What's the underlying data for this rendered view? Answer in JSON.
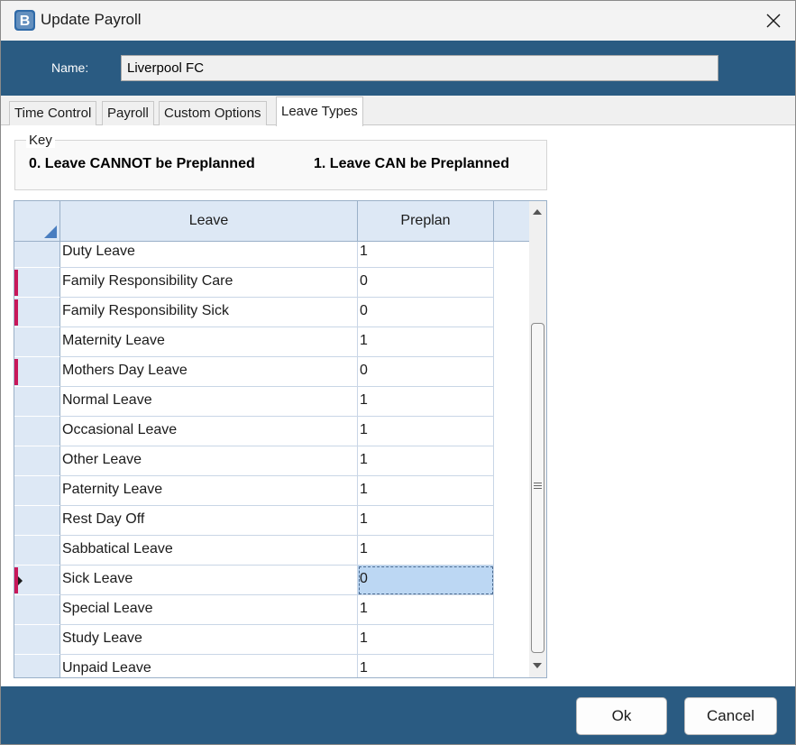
{
  "window": {
    "title": "Update Payroll",
    "app_icon": "app-logo-icon",
    "close_icon": "close-icon"
  },
  "header": {
    "name_label": "Name:",
    "name_value": "Liverpool FC"
  },
  "tabs": [
    {
      "label": "Time Control",
      "active": false
    },
    {
      "label": "Payroll",
      "active": false
    },
    {
      "label": "Custom Options",
      "active": false
    },
    {
      "label": "Leave Types",
      "active": true
    }
  ],
  "key": {
    "legend": "Key",
    "item_0": "0. Leave CANNOT be Preplanned",
    "item_1": "1. Leave CAN be Preplanned"
  },
  "grid": {
    "columns": [
      "Leave",
      "Preplan"
    ],
    "rows": [
      {
        "leave": "Duty Leave",
        "preplan": "1"
      },
      {
        "leave": "Family Responsibility Care",
        "preplan": "0"
      },
      {
        "leave": "Family Responsibility Sick",
        "preplan": "0"
      },
      {
        "leave": "Maternity Leave",
        "preplan": "1"
      },
      {
        "leave": "Mothers Day Leave",
        "preplan": "0"
      },
      {
        "leave": "Normal Leave",
        "preplan": "1"
      },
      {
        "leave": "Occasional Leave",
        "preplan": "1"
      },
      {
        "leave": "Other Leave",
        "preplan": "1"
      },
      {
        "leave": "Paternity Leave",
        "preplan": "1"
      },
      {
        "leave": "Rest Day Off",
        "preplan": "1"
      },
      {
        "leave": "Sabbatical Leave",
        "preplan": "1"
      },
      {
        "leave": "Sick Leave",
        "preplan": "0",
        "current": true
      },
      {
        "leave": "Special Leave",
        "preplan": "1"
      },
      {
        "leave": "Study Leave",
        "preplan": "1"
      },
      {
        "leave": "Unpaid Leave",
        "preplan": "1"
      }
    ],
    "flag_color": "#c8185a",
    "selection_color": "#bcd7f3"
  },
  "buttons": {
    "ok": "Ok",
    "cancel": "Cancel"
  },
  "colors": {
    "band": "#2a5b82",
    "grid_header": "#dde8f5"
  }
}
